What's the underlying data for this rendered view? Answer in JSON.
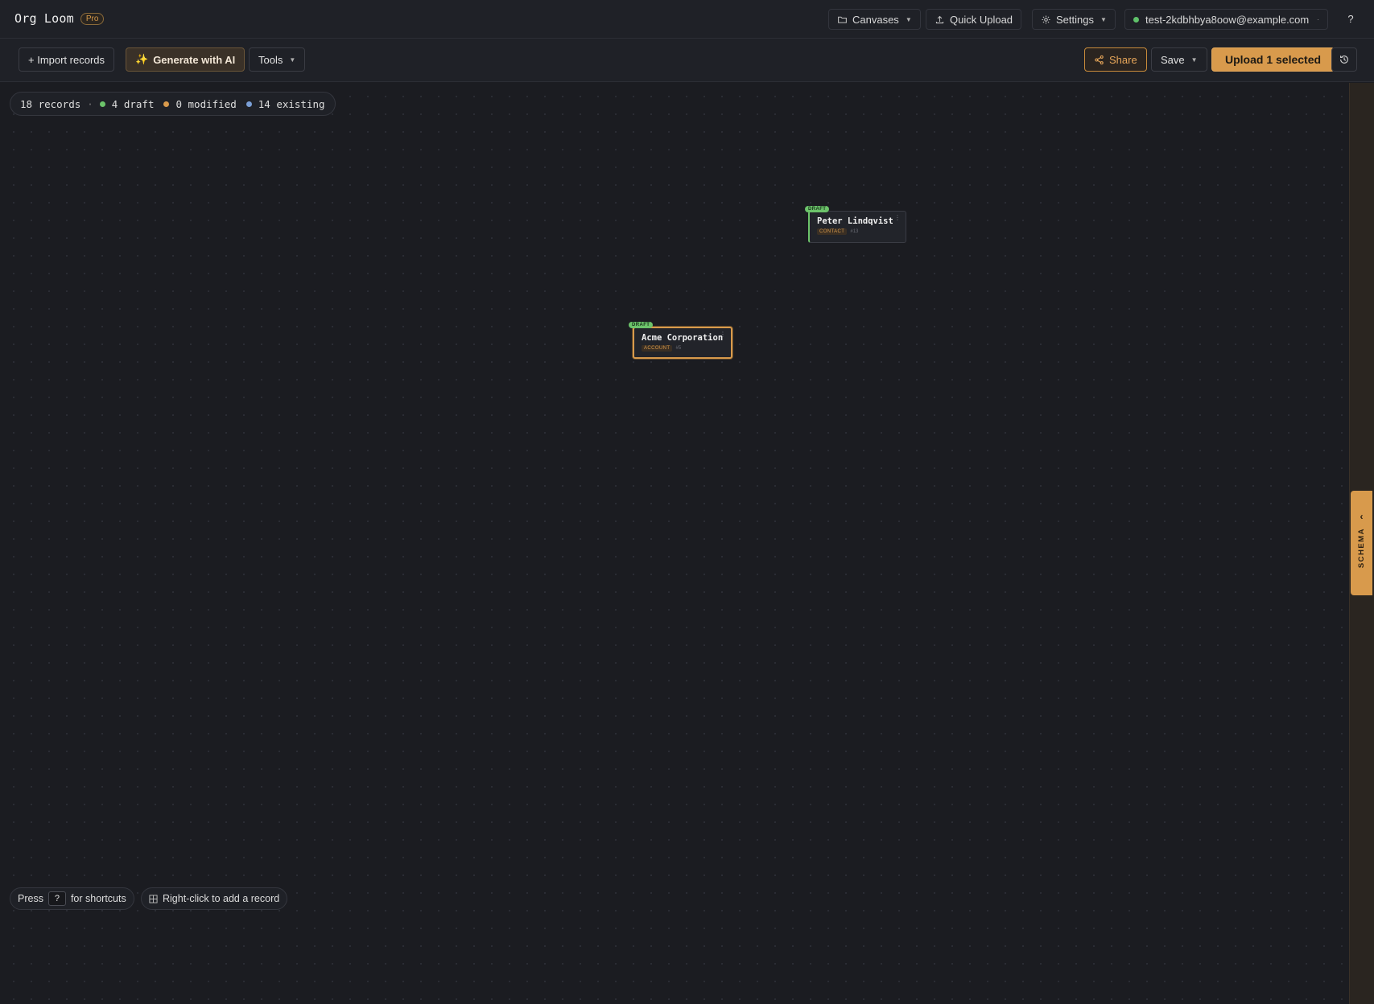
{
  "app": {
    "name": "Org Loom",
    "plan_badge": "Pro"
  },
  "header": {
    "canvases_label": "Canvases",
    "quick_upload_label": "Quick Upload",
    "settings_label": "Settings",
    "user_email": "test-2kdbhbya8oow@example.com",
    "help_label": "?"
  },
  "toolbar": {
    "import_label": "+ Import records",
    "generate_ai_label": "Generate with AI",
    "tools_label": "Tools",
    "share_label": "Share",
    "save_label": "Save",
    "upload_label": "Upload 1 selected"
  },
  "stats": {
    "records": "18 records",
    "draft": "4 draft",
    "modified": "0 modified",
    "existing": "14 existing"
  },
  "nodes": [
    {
      "badge": "DRAFT",
      "title": "Peter Lindqvist",
      "type": "CONTACT",
      "id": "#13",
      "menu": "⋮"
    },
    {
      "badge": "DRAFT",
      "title": "Acme Corporation",
      "type": "ACCOUNT",
      "id": "#5",
      "menu": "⋮"
    }
  ],
  "footer": {
    "press_label": "Press",
    "shortcut_key": "?",
    "shortcuts_suffix": "for shortcuts",
    "right_click_hint": "Right-click to add a record"
  },
  "schema_panel": {
    "label": "SCHEMA"
  },
  "colors": {
    "accent": "#d89a4c",
    "draft": "#6cc36a",
    "modified": "#d89a4c",
    "existing": "#7a9fd6",
    "background": "#1b1c21"
  }
}
